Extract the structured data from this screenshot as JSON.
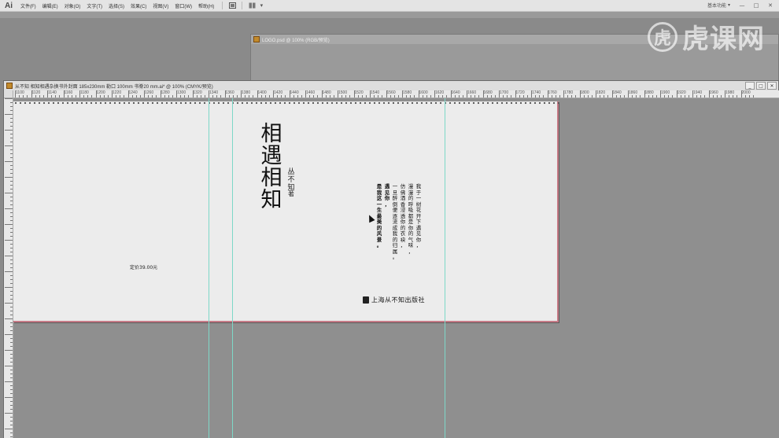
{
  "app": {
    "logo": "Ai",
    "menu": [
      "文件(F)",
      "编辑(E)",
      "对象(O)",
      "文字(T)",
      "选择(S)",
      "效果(C)",
      "视图(V)",
      "窗口(W)",
      "帮助(H)"
    ],
    "workspace_label": "基本功能",
    "win_minimize": "—",
    "win_maximize": "□",
    "win_close": "✕"
  },
  "watermark": {
    "circle_char": "虎",
    "text": "虎课网"
  },
  "logo_window": {
    "title": "LOGO.psd @ 100% (RGB/预览)"
  },
  "main_window": {
    "title": "从不知  相知相遇杂换书外封面  185x230mm  勒口 100mm  书脊20 mm.ai* @ 100% (CMYK/预览)",
    "ctrl_min": "_",
    "ctrl_max": "□",
    "ctrl_close": "✕"
  },
  "ruler": {
    "top_labels": [
      "1100",
      "1120",
      "1140",
      "1160",
      "1180",
      "1200",
      "1220",
      "1240",
      "1260",
      "1280",
      "1300",
      "1320",
      "1340",
      "1360",
      "1380",
      "1400",
      "1420",
      "1440",
      "1460",
      "1480",
      "1500",
      "1520",
      "1540",
      "1560",
      "1580",
      "1600",
      "1620",
      "1640",
      "1660",
      "1680",
      "1700",
      "1720",
      "1740",
      "1760",
      "1780",
      "1800",
      "1820",
      "1840",
      "1860",
      "1880",
      "1900",
      "1920",
      "1940",
      "1960",
      "1980",
      "2000"
    ]
  },
  "cover": {
    "title_chars": [
      "相",
      "遇",
      "相",
      "知"
    ],
    "author_chars": [
      "丛",
      "不",
      "知"
    ],
    "author_suffix": "著",
    "poem_columns": [
      {
        "text": "我于一树花开下遇见你，",
        "bold": false
      },
      {
        "text": "漫漫的呼吸都是你的气味，",
        "bold": false
      },
      {
        "text": "仿佛酒香浸透你的衣袂，",
        "bold": false
      },
      {
        "text": "一旦醉倒便逐流成我的归属。",
        "bold": false
      },
      {
        "text": "遇见你，",
        "bold": true
      },
      {
        "text": "是我这一生最美的风景。",
        "bold": true
      }
    ],
    "price": "定价39.00元",
    "publisher": "上海从不知出版社"
  }
}
